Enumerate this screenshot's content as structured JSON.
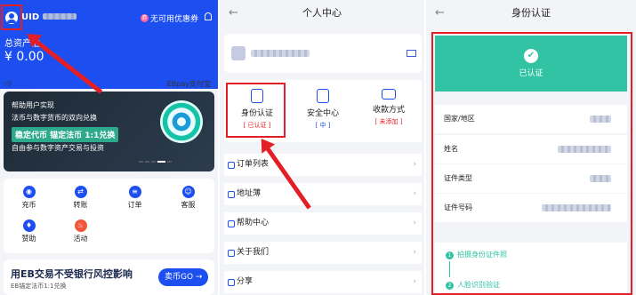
{
  "screen1": {
    "uid_label": "UID",
    "coupon": "无可用优惠券",
    "asset_label": "总资产估",
    "asset_value": "¥ 0.00",
    "ebpay": "EBpay支付宝",
    "banner": {
      "line1": "帮助用户实现",
      "line2": "法币与数字货币的双向兑换",
      "highlight": "稳定代币 锚定法币 1:1兑换",
      "line4": "自由参与数字资产交易与投资"
    },
    "grid": [
      {
        "label": "充币",
        "icon": "deposit-icon"
      },
      {
        "label": "转账",
        "icon": "transfer-icon"
      },
      {
        "label": "订单",
        "icon": "order-icon"
      },
      {
        "label": "客服",
        "icon": "service-icon"
      },
      {
        "label": "赞助",
        "icon": "sponsor-icon"
      },
      {
        "label": "活动",
        "icon": "activity-icon"
      }
    ],
    "promo": {
      "title": "用EB交易不受银行风控影响",
      "subtitle": "EB锚定法币1:1兑换",
      "button": "卖币GO →"
    }
  },
  "screen2": {
    "title": "个人中心",
    "menu": [
      {
        "label": "身份认证",
        "status": "[ 已认证 ]",
        "status_color": "#e41e25"
      },
      {
        "label": "安全中心",
        "status": "[ 中 ]",
        "status_color": "#1c4ef0"
      },
      {
        "label": "收款方式",
        "status": "[ 未添加 ]",
        "status_color": "#e41e25"
      }
    ],
    "list": [
      "订单列表",
      "地址薄",
      "帮助中心",
      "关于我们",
      "分享"
    ]
  },
  "screen3": {
    "title": "身份认证",
    "verified": "已认证",
    "fields": [
      "国家/地区",
      "姓名",
      "证件类型",
      "证件号码"
    ],
    "steps": [
      "拍摄身份证件照",
      "人脸识别验证"
    ]
  },
  "colors": {
    "accent": "#1c4ef0",
    "highlight": "#e41e25",
    "success": "#31c3a4"
  }
}
